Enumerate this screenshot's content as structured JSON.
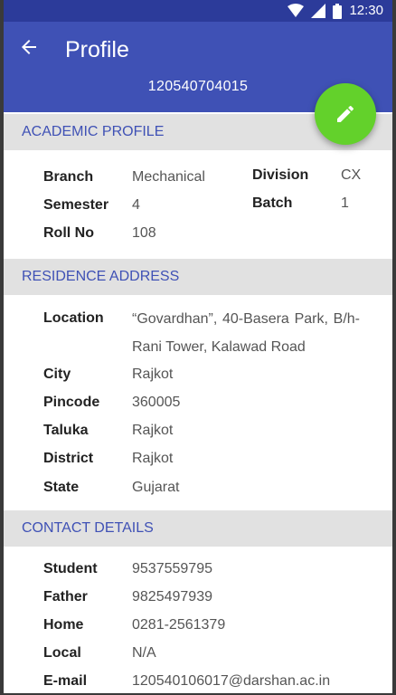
{
  "status_bar": {
    "time": "12:30",
    "icons": [
      "wifi-icon",
      "signal-icon",
      "battery-icon"
    ]
  },
  "toolbar": {
    "title": "Profile",
    "subtitle": "120540704015",
    "back_icon": "arrow-left-icon",
    "fab_icon": "pencil-icon"
  },
  "academic": {
    "heading": "ACADEMIC PROFILE",
    "branch_label": "Branch",
    "branch_value": "Mechanical",
    "semester_label": "Semester",
    "semester_value": "4",
    "rollno_label": "Roll No",
    "rollno_value": "108",
    "division_label": "Division",
    "division_value": "CX",
    "batch_label": "Batch",
    "batch_value": "1"
  },
  "residence": {
    "heading": "RESIDENCE ADDRESS",
    "location_label": "Location",
    "location_value": "“Govardhan”, 40-Basera Park, B/h-Rani Tower, Kalawad Road",
    "city_label": "City",
    "city_value": "Rajkot",
    "pincode_label": "Pincode",
    "pincode_value": "360005",
    "taluka_label": "Taluka",
    "taluka_value": "Rajkot",
    "district_label": "District",
    "district_value": "Rajkot",
    "state_label": "State",
    "state_value": "Gujarat"
  },
  "contact": {
    "heading": "CONTACT DETAILS",
    "student_label": "Student",
    "student_value": "9537559795",
    "father_label": "Father",
    "father_value": "9825497939",
    "home_label": "Home",
    "home_value": "0281-2561379",
    "local_label": "Local",
    "local_value": "N/A",
    "email_label": "E-mail",
    "email_value": "120540106017@darshan.ac.in"
  },
  "colors": {
    "primary": "#3f51b5",
    "primary_dark": "#2c3b9a",
    "fab": "#63d12b",
    "section_bg": "#e1e1e1"
  }
}
